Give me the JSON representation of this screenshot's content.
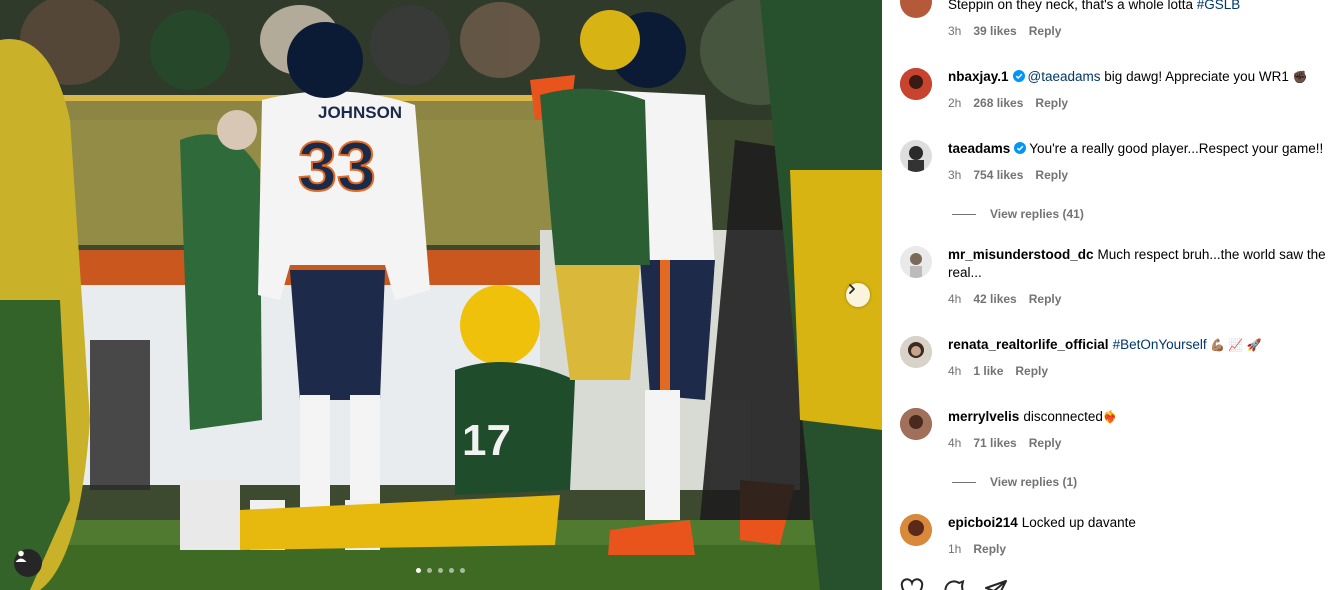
{
  "post": {
    "carousel": {
      "slide_count": 5,
      "active_index": 0
    }
  },
  "comments": [
    {
      "username": "",
      "verified": false,
      "text": "Steppin on they neck, that's a whole lotta ",
      "hashtags": "#GSLB",
      "time": "3h",
      "likes": "39 likes",
      "reply": "Reply"
    },
    {
      "username": "nbaxjay.1",
      "verified": true,
      "mention": "@taeadams",
      "text": " big dawg! Appreciate you WR1 ",
      "emoji": "✊🏿",
      "time": "2h",
      "likes": "268 likes",
      "reply": "Reply"
    },
    {
      "username": "taeadams",
      "verified": true,
      "text": "You're a really good player...Respect your game!!",
      "time": "3h",
      "likes": "754 likes",
      "reply": "Reply",
      "view_replies": "View replies (41)"
    },
    {
      "username": "mr_misunderstood_dc",
      "verified": false,
      "text": "Much respect bruh...the world saw the real...",
      "time": "4h",
      "likes": "42 likes",
      "reply": "Reply"
    },
    {
      "username": "renata_realtorlife_official",
      "verified": false,
      "hashtags": "#BetOnYourself",
      "emoji": " 💪🏽 📈 🚀",
      "time": "4h",
      "likes": "1 like",
      "reply": "Reply"
    },
    {
      "username": "merrylvelis",
      "verified": false,
      "text": "disconnected",
      "emoji": "❤️‍🔥",
      "time": "4h",
      "likes": "71 likes",
      "reply": "Reply",
      "view_replies": "View replies (1)"
    },
    {
      "username": "epicboi214",
      "verified": false,
      "text": "Locked up davante",
      "time": "1h",
      "reply": "Reply"
    }
  ],
  "icons": {
    "carousel_next": "chevron-right-icon",
    "tags": "person-icon",
    "verified": "verified-badge-icon",
    "like": "heart-icon",
    "comment": "comment-icon",
    "share": "send-icon"
  },
  "colors": {
    "link": "#00376b",
    "muted": "#737373",
    "verified": "#0095f6"
  }
}
